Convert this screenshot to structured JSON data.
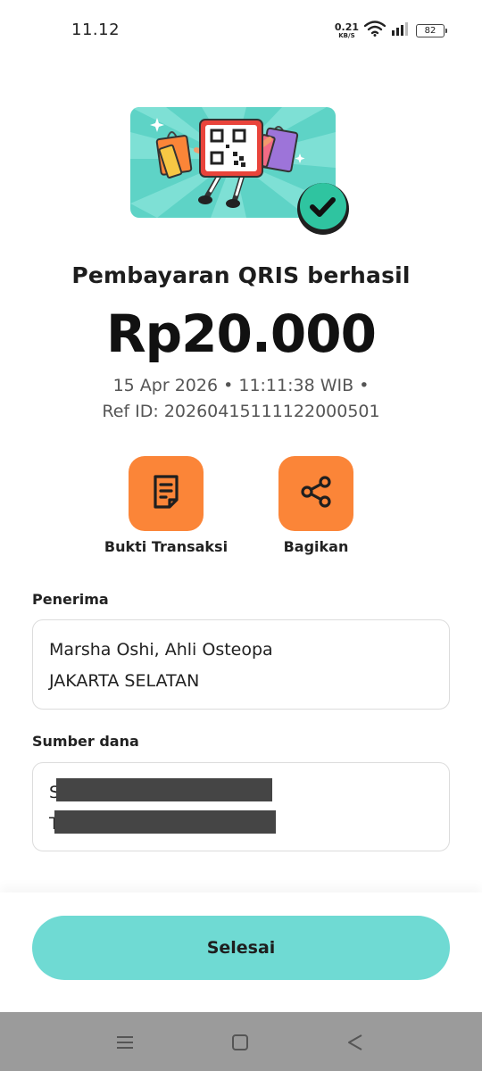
{
  "status_bar": {
    "time": "11.12",
    "net_speed_value": "0.21",
    "net_speed_unit": "KB/S",
    "battery": "82",
    "icons": [
      "wifi-icon",
      "signal-icon",
      "battery-icon"
    ]
  },
  "illustration": {
    "name": "qris-success-illustration",
    "icons": [
      "qr-code-icon",
      "shopping-bag-icon",
      "check-badge-icon"
    ]
  },
  "result": {
    "title": "Pembayaran QRIS berhasil",
    "amount": "Rp20.000",
    "datetime": "15 Apr 2026 • 11:11:38 WIB •",
    "ref_id": "Ref ID: 20260415111122000501"
  },
  "actions": {
    "receipt_label": "Bukti Transaksi",
    "receipt_icon": "receipt-icon",
    "share_label": "Bagikan",
    "share_icon": "share-icon"
  },
  "recipient": {
    "label": "Penerima",
    "name": "Marsha Oshi, Ahli Osteopa",
    "city": "JAKARTA SELATAN"
  },
  "source": {
    "label": "Sumber dana",
    "line1_visible": "S",
    "line2_visible": "T"
  },
  "footer": {
    "done_label": "Selesai"
  },
  "nav": {
    "icons": [
      "menu-icon",
      "home-square-icon",
      "back-triangle-icon"
    ]
  },
  "colors": {
    "accent_orange": "#fb8538",
    "done_button": "#6fdad3",
    "illus_bg": "#5ed3c6",
    "check_green": "#2fc4a0"
  }
}
